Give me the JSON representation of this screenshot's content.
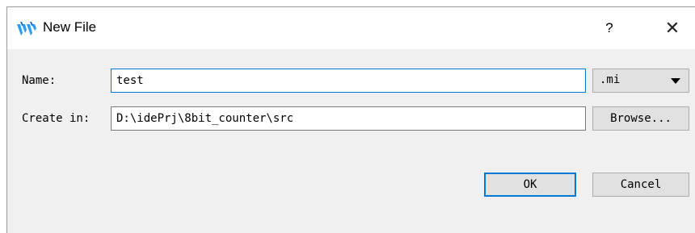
{
  "window": {
    "title": "New File",
    "help_label": "?",
    "close_label": "✕"
  },
  "form": {
    "name_label": "Name:",
    "name_value": "test",
    "extension_selected": ".mi",
    "create_in_label": "Create in:",
    "create_in_value": "D:\\idePrj\\8bit_counter\\src",
    "browse_label": "Browse..."
  },
  "actions": {
    "ok_label": "OK",
    "cancel_label": "Cancel"
  },
  "colors": {
    "accent": "#0078d7",
    "dialog_bg": "#f0f0f0",
    "logo_blue": "#2a9df4"
  },
  "icons": {
    "app": "gowin-logo-icon",
    "dropdown": "chevron-down-icon",
    "close": "close-icon"
  }
}
